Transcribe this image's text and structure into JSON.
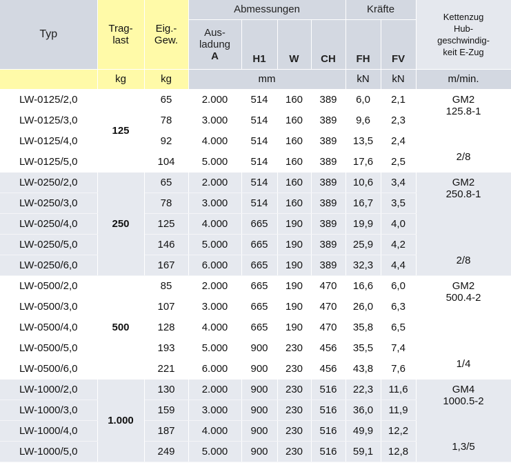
{
  "header": {
    "typ": "Typ",
    "traglast": [
      "Trag-",
      "last"
    ],
    "eiggew": [
      "Eig.-",
      "Gew."
    ],
    "abmessungen": "Abmessungen",
    "kraefte": "Kräfte",
    "kettenzug": [
      "Kettenzug",
      "Hub-",
      "geschwindig-",
      "keit E-Zug"
    ],
    "ausladung": [
      "Aus-",
      "ladung",
      "A"
    ],
    "h1": "H1",
    "w": "W",
    "ch": "CH",
    "fh": "FH",
    "fv": "FV"
  },
  "units": {
    "traglast": "kg",
    "eiggew": "kg",
    "abm": "mm",
    "fh": "kN",
    "fv": "kN",
    "speed": "m/min."
  },
  "groups": [
    {
      "traglast": "125",
      "motor": [
        "GM2",
        "125.8-1"
      ],
      "speed": "2/8",
      "rows": [
        [
          "LW-0125/2,0",
          "65",
          "2.000",
          "514",
          "160",
          "389",
          "6,0",
          "2,1"
        ],
        [
          "LW-0125/3,0",
          "78",
          "3.000",
          "514",
          "160",
          "389",
          "9,6",
          "2,3"
        ],
        [
          "LW-0125/4,0",
          "92",
          "4.000",
          "514",
          "160",
          "389",
          "13,5",
          "2,4"
        ],
        [
          "LW-0125/5,0",
          "104",
          "5.000",
          "514",
          "160",
          "389",
          "17,6",
          "2,5"
        ]
      ]
    },
    {
      "traglast": "250",
      "motor": [
        "GM2",
        "250.8-1"
      ],
      "speed": "2/8",
      "rows": [
        [
          "LW-0250/2,0",
          "65",
          "2.000",
          "514",
          "160",
          "389",
          "10,6",
          "3,4"
        ],
        [
          "LW-0250/3,0",
          "78",
          "3.000",
          "514",
          "160",
          "389",
          "16,7",
          "3,5"
        ],
        [
          "LW-0250/4,0",
          "125",
          "4.000",
          "665",
          "190",
          "389",
          "19,9",
          "4,0"
        ],
        [
          "LW-0250/5,0",
          "146",
          "5.000",
          "665",
          "190",
          "389",
          "25,9",
          "4,2"
        ],
        [
          "LW-0250/6,0",
          "167",
          "6.000",
          "665",
          "190",
          "389",
          "32,3",
          "4,4"
        ]
      ]
    },
    {
      "traglast": "500",
      "motor": [
        "GM2",
        "500.4-2"
      ],
      "speed": "1/4",
      "rows": [
        [
          "LW-0500/2,0",
          "85",
          "2.000",
          "665",
          "190",
          "470",
          "16,6",
          "6,0"
        ],
        [
          "LW-0500/3,0",
          "107",
          "3.000",
          "665",
          "190",
          "470",
          "26,0",
          "6,3"
        ],
        [
          "LW-0500/4,0",
          "128",
          "4.000",
          "665",
          "190",
          "470",
          "35,8",
          "6,5"
        ],
        [
          "LW-0500/5,0",
          "193",
          "5.000",
          "900",
          "230",
          "456",
          "35,5",
          "7,4"
        ],
        [
          "LW-0500/6,0",
          "221",
          "6.000",
          "900",
          "230",
          "456",
          "43,8",
          "7,6"
        ]
      ]
    },
    {
      "traglast": "1.000",
      "motor": [
        "GM4",
        "1000.5-2"
      ],
      "speed": "1,3/5",
      "rows": [
        [
          "LW-1000/2,0",
          "130",
          "2.000",
          "900",
          "230",
          "516",
          "22,3",
          "11,6"
        ],
        [
          "LW-1000/3,0",
          "159",
          "3.000",
          "900",
          "230",
          "516",
          "36,0",
          "11,9"
        ],
        [
          "LW-1000/4,0",
          "187",
          "4.000",
          "900",
          "230",
          "516",
          "49,9",
          "12,2"
        ],
        [
          "LW-1000/5,0",
          "249",
          "5.000",
          "900",
          "230",
          "516",
          "59,1",
          "12,8"
        ]
      ]
    }
  ]
}
